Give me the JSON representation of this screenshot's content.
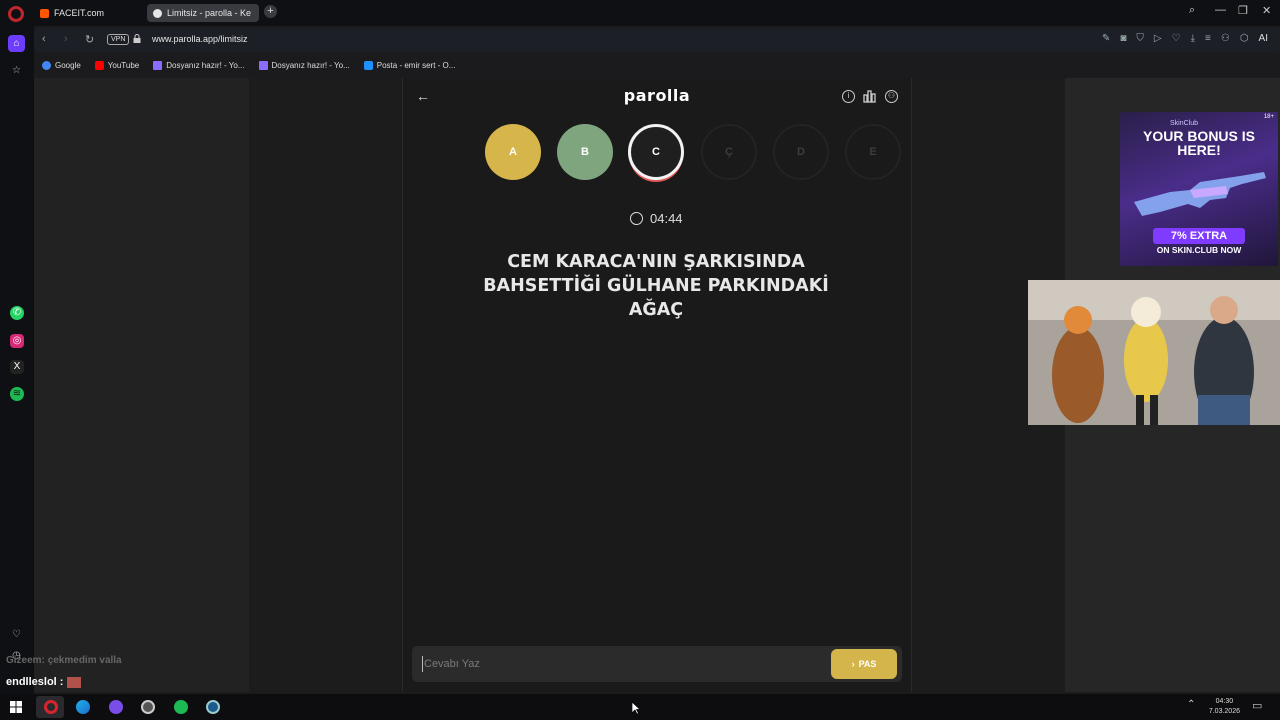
{
  "browser": {
    "tabs": [
      {
        "label": "FACEIT.com",
        "favicon_color": "#ff5500"
      },
      {
        "label": "Limitsiz - parolla - Ke",
        "favicon_color": "#e6e6e6"
      }
    ],
    "url": "www.parolla.app/limitsiz",
    "vpn_label": "VPN",
    "ai_label": "AI",
    "bookmarks": [
      {
        "label": "Google",
        "color": "#4285f4"
      },
      {
        "label": "YouTube",
        "color": "#ff0000"
      },
      {
        "label": "Dosyanız hazır! - Yo...",
        "color": "#8b6cff"
      },
      {
        "label": "Dosyanız hazır! - Yo...",
        "color": "#8b6cff"
      },
      {
        "label": "Posta - emir sert - O...",
        "color": "#1e90ff"
      }
    ]
  },
  "game": {
    "brand": "parolla",
    "letters": [
      {
        "letter": "A",
        "state": "correct",
        "color": "#d6b54a"
      },
      {
        "letter": "B",
        "state": "passed",
        "color": "#7fa57f"
      },
      {
        "letter": "C",
        "state": "active",
        "color": "#1f1f1f"
      },
      {
        "letter": "Ç",
        "state": "pending",
        "color": "#1a1a1a"
      },
      {
        "letter": "D",
        "state": "pending",
        "color": "#1a1a1a"
      },
      {
        "letter": "E",
        "state": "pending",
        "color": "#1a1a1a"
      }
    ],
    "timer": "04:44",
    "question_lines": [
      "CEM KARACA'NIN ŞARKISINDA",
      "BAHSETTİĞİ GÜLHANE PARKINDAKİ",
      "AĞAÇ"
    ],
    "answer_placeholder": "Cevabı Yaz",
    "answer_value": "",
    "pass_label": "PAS"
  },
  "ad": {
    "brand": "SkinClub",
    "age": "18+",
    "headline": "YOUR BONUS IS HERE!",
    "pill": "7% EXTRA",
    "sub": "ON SKIN.CLUB NOW"
  },
  "chat": {
    "faded_user": "Gizeem",
    "faded_message": "çekmedim valla",
    "user": "endlleslol :"
  },
  "system": {
    "time": "04:30",
    "date": "7.03.2026"
  }
}
